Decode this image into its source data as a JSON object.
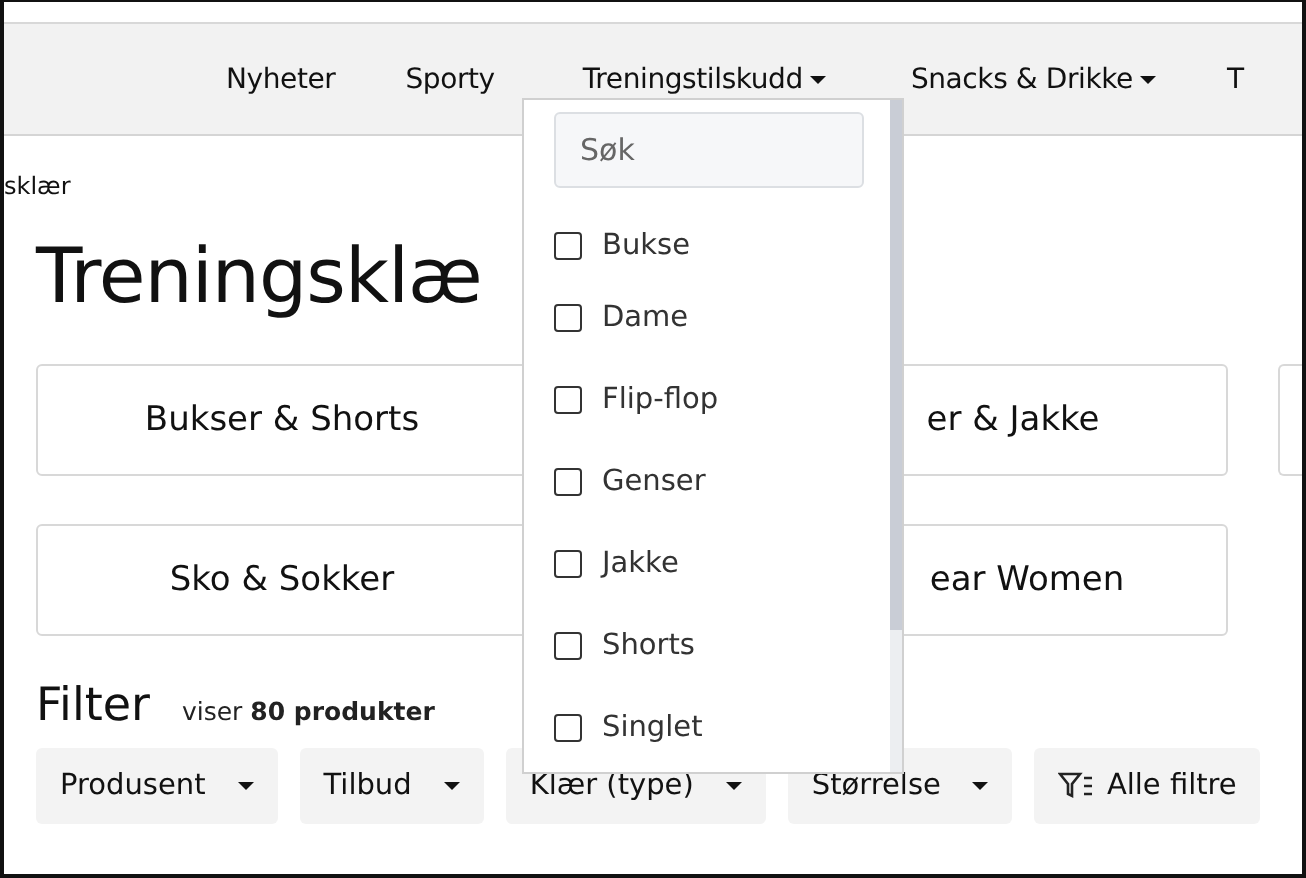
{
  "nav": {
    "items": [
      {
        "label": "Nyheter",
        "dropdown": false
      },
      {
        "label": "Sporty",
        "dropdown": false
      },
      {
        "label": "Treningstilskudd",
        "dropdown": true
      },
      {
        "label": "Snacks & Drikke",
        "dropdown": true
      },
      {
        "label": "T",
        "dropdown": false
      }
    ]
  },
  "breadcrumb": "sklær",
  "title": "Treningsklæ",
  "categories": [
    {
      "label": "Bukser & Shorts"
    },
    {
      "label": "er & Jakke"
    },
    {
      "kind": "cut"
    },
    {
      "label": "Sko & Sokker"
    },
    {
      "label": "ear Women"
    }
  ],
  "filter": {
    "heading": "Filter",
    "count": "viser **80 produkter**",
    "buttons": [
      {
        "label": "Produsent",
        "kind": "dropdown"
      },
      {
        "label": "Tilbud",
        "kind": "dropdown"
      },
      {
        "label": "Klær (type)",
        "kind": "dropdown"
      },
      {
        "label": "Størrelse",
        "kind": "dropdown"
      },
      {
        "label": "Alle filtre",
        "kind": "all"
      }
    ]
  },
  "dropdown_menu": {
    "search": {
      "placeholder": "Søk"
    },
    "options": [
      {
        "label": "Bukse",
        "checked": false
      },
      {
        "label": "Dame",
        "checked": false
      },
      {
        "label": "Flip-flop",
        "checked": false
      },
      {
        "label": "Genser",
        "checked": false
      },
      {
        "label": "Jakke",
        "checked": false
      },
      {
        "label": "Shorts",
        "checked": false
      },
      {
        "label": "Singlet",
        "checked": false
      }
    ]
  }
}
